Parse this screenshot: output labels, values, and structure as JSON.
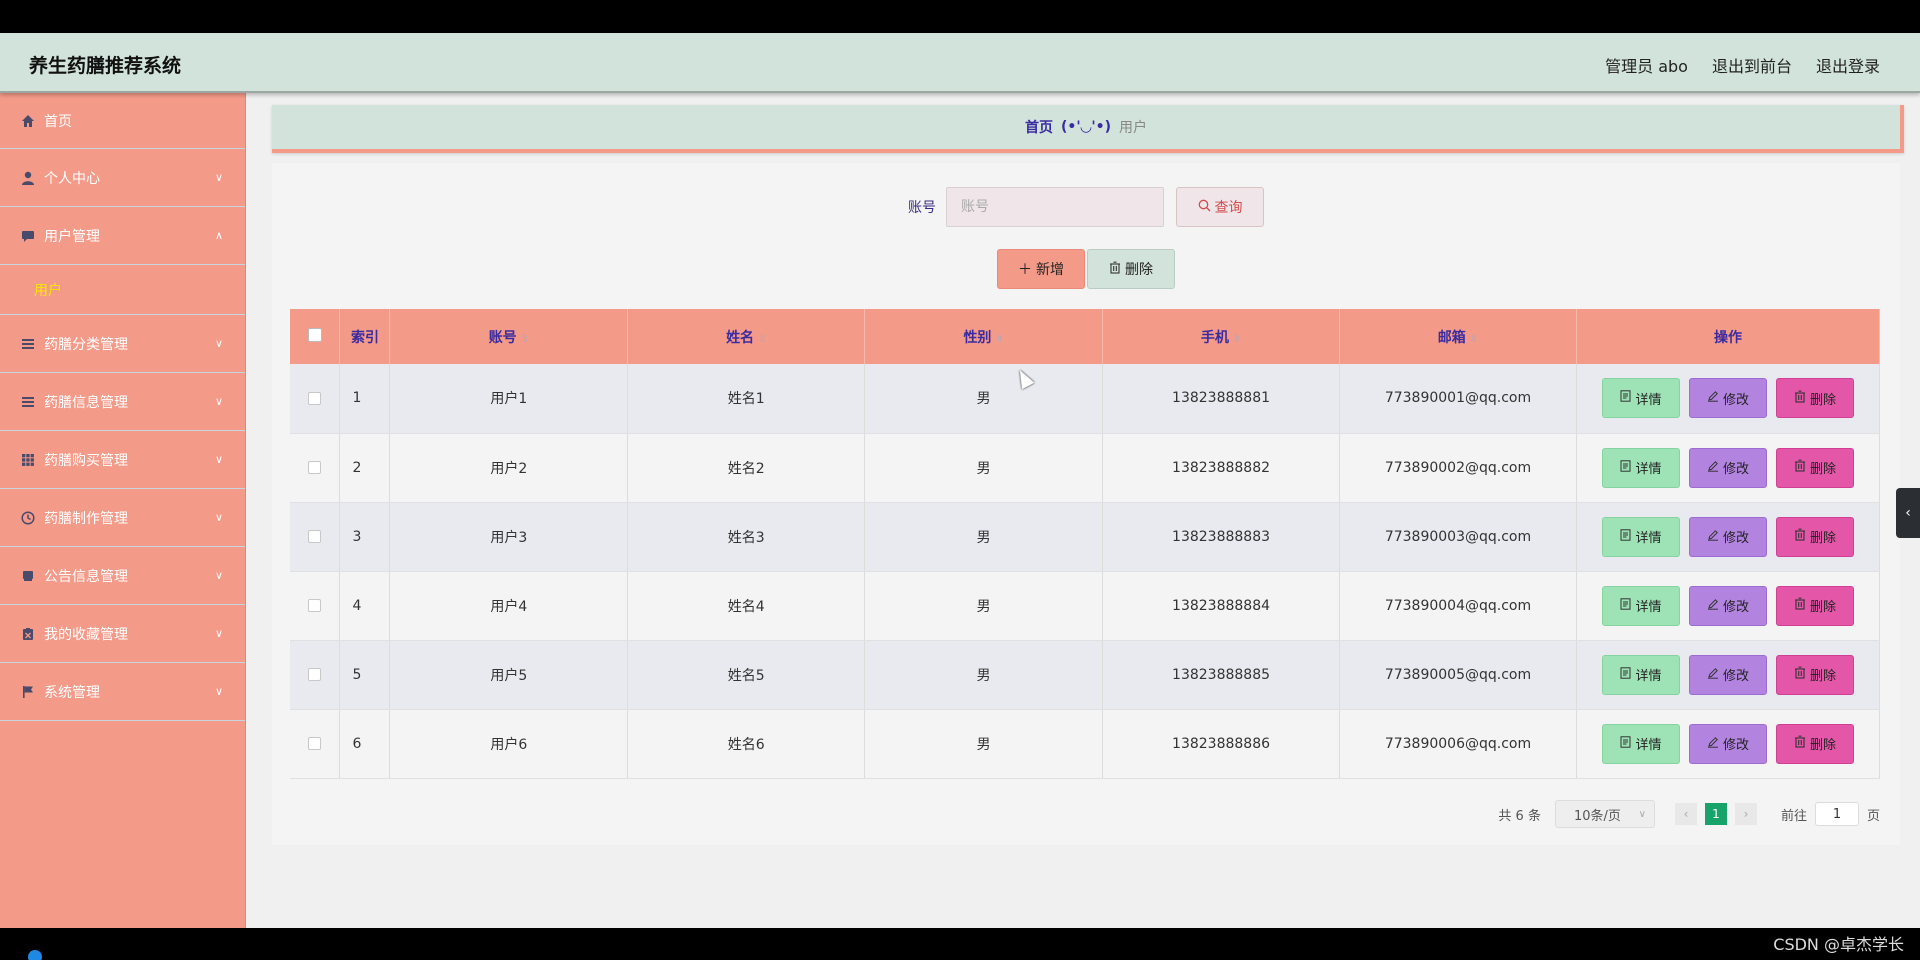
{
  "header": {
    "title": "养生药膳推荐系统",
    "admin": "管理员 abo",
    "to_front": "退出到前台",
    "logout": "退出登录"
  },
  "sidebar": {
    "items": [
      {
        "label": "首页",
        "icon": "home-icon"
      },
      {
        "label": "个人中心",
        "icon": "user-icon"
      },
      {
        "label": "用户管理",
        "icon": "chat-icon"
      },
      {
        "label": "药膳分类管理",
        "icon": "list-icon"
      },
      {
        "label": "药膳信息管理",
        "icon": "list-icon"
      },
      {
        "label": "药膳购买管理",
        "icon": "grid-icon"
      },
      {
        "label": "药膳制作管理",
        "icon": "clock-icon"
      },
      {
        "label": "公告信息管理",
        "icon": "notice-icon"
      },
      {
        "label": "我的收藏管理",
        "icon": "clipboard-icon"
      },
      {
        "label": "系统管理",
        "icon": "flag-icon"
      }
    ],
    "sub_user": "用户"
  },
  "breadcrumb": {
    "home": "首页",
    "face": "(•'◡'•)",
    "current": "用户"
  },
  "search": {
    "label": "账号",
    "placeholder": "账号",
    "button": "查询"
  },
  "actions": {
    "add": "新增",
    "delete": "删除"
  },
  "table": {
    "headers": {
      "index": "索引",
      "account": "账号",
      "name": "姓名",
      "gender": "性别",
      "phone": "手机",
      "email": "邮箱",
      "ops": "操作"
    },
    "rows": [
      {
        "index": "1",
        "account": "用户1",
        "name": "姓名1",
        "gender": "男",
        "phone": "13823888881",
        "email": "773890001@qq.com"
      },
      {
        "index": "2",
        "account": "用户2",
        "name": "姓名2",
        "gender": "男",
        "phone": "13823888882",
        "email": "773890002@qq.com"
      },
      {
        "index": "3",
        "account": "用户3",
        "name": "姓名3",
        "gender": "男",
        "phone": "13823888883",
        "email": "773890003@qq.com"
      },
      {
        "index": "4",
        "account": "用户4",
        "name": "姓名4",
        "gender": "男",
        "phone": "13823888884",
        "email": "773890004@qq.com"
      },
      {
        "index": "5",
        "account": "用户5",
        "name": "姓名5",
        "gender": "男",
        "phone": "13823888885",
        "email": "773890005@qq.com"
      },
      {
        "index": "6",
        "account": "用户6",
        "name": "姓名6",
        "gender": "男",
        "phone": "13823888886",
        "email": "773890006@qq.com"
      }
    ],
    "ops": {
      "detail": "详情",
      "edit": "修改",
      "delete": "删除"
    }
  },
  "pager": {
    "total": "共 6 条",
    "page_size": "10条/页",
    "current_page": "1",
    "goto_label": "前往",
    "goto_value": "1",
    "page_suffix": "页"
  },
  "watermark": "CSDN @卓杰学长",
  "colors": {
    "header_bg": "#d2e3dc",
    "sidebar_bg": "#f49a89",
    "accent_text": "#3a2ca0",
    "detail_btn": "#9ee3b6",
    "edit_btn": "#b383e0",
    "delete_btn": "#e356a8",
    "pager_active": "#18a36a"
  }
}
